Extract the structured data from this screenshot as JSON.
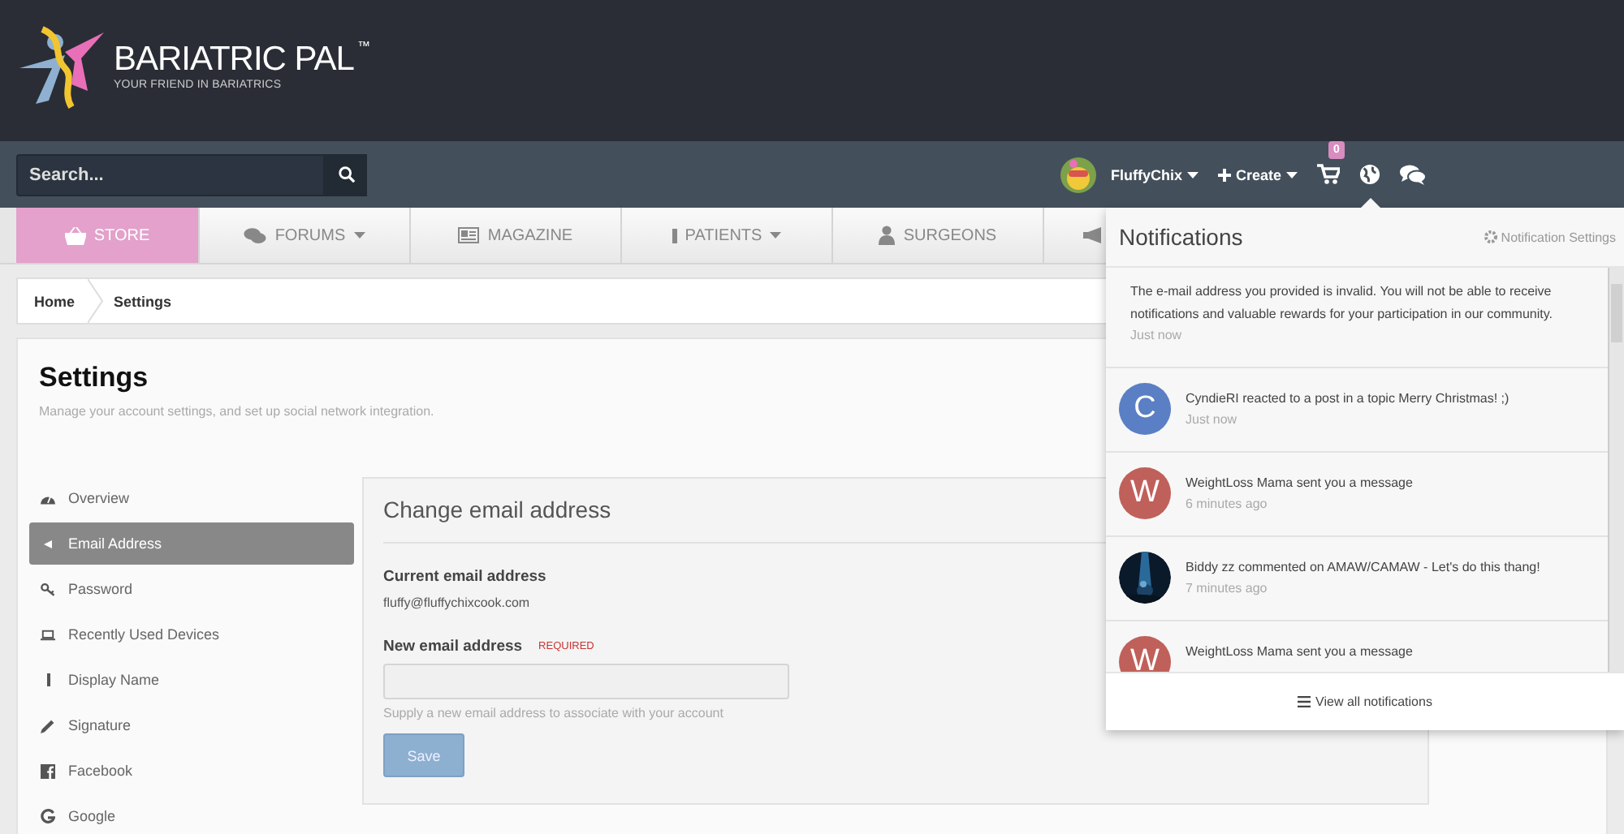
{
  "header": {
    "brand": "BARIATRIC PAL",
    "trademark": "™",
    "tagline": "YOUR FRIEND IN BARIATRICS"
  },
  "navbar": {
    "search": {
      "placeholder": "Search..."
    },
    "user": "FluffyChix",
    "create": "Create",
    "cart_count": "0"
  },
  "menu": [
    {
      "label": "STORE",
      "caret": false,
      "selected": true
    },
    {
      "label": "FORUMS",
      "caret": true,
      "selected": false
    },
    {
      "label": "MAGAZINE",
      "caret": false,
      "selected": false
    },
    {
      "label": "PATIENTS",
      "caret": true,
      "selected": false
    },
    {
      "label": "SURGEONS",
      "caret": false,
      "selected": false
    },
    {
      "caret": false,
      "selected": false
    }
  ],
  "breadcrumb": [
    "Home",
    "Settings"
  ],
  "page": {
    "title": "Settings",
    "subtitle": "Manage your account settings, and set up social network integration."
  },
  "sidebar": [
    {
      "label": "Overview",
      "selected": false
    },
    {
      "label": "Email Address",
      "selected": true
    },
    {
      "label": "Password",
      "selected": false
    },
    {
      "label": "Recently Used Devices",
      "selected": false
    },
    {
      "label": "Display Name",
      "selected": false
    },
    {
      "label": "Signature",
      "selected": false
    },
    {
      "label": "Facebook",
      "selected": false
    },
    {
      "label": "Google",
      "selected": false
    }
  ],
  "form": {
    "title": "Change email address",
    "current_label": "Current email address",
    "current_value": "fluffy@fluffychixcook.com",
    "new_label": "New email address",
    "required": "REQUIRED",
    "hint": "Supply a new email address to associate with your account",
    "save": "Save",
    "save_disabled": true
  },
  "notifications": {
    "title": "Notifications",
    "settings_link": "Notification Settings",
    "footer": "View all notifications",
    "items": [
      {
        "kind": "system",
        "text": "The e-mail address you provided is invalid. You will not be able to receive notifications and valuable rewards for your participation in our community.",
        "time": "Just now"
      },
      {
        "kind": "letter",
        "letter": "C",
        "color": "#5b7fc4",
        "text": "CyndieRI reacted to a post in a topic Merry Christmas! ;)",
        "time": "Just now"
      },
      {
        "kind": "letter",
        "letter": "W",
        "color": "#c0605a",
        "text": "WeightLoss Mama sent you a message",
        "time": "6 minutes ago"
      },
      {
        "kind": "picture",
        "text": "Biddy zz commented on AMAW/CAMAW - Let's do this thang!",
        "time": "7 minutes ago"
      },
      {
        "kind": "letter",
        "letter": "W",
        "color": "#c0605a",
        "text": "WeightLoss Mama sent you a message"
      }
    ]
  }
}
